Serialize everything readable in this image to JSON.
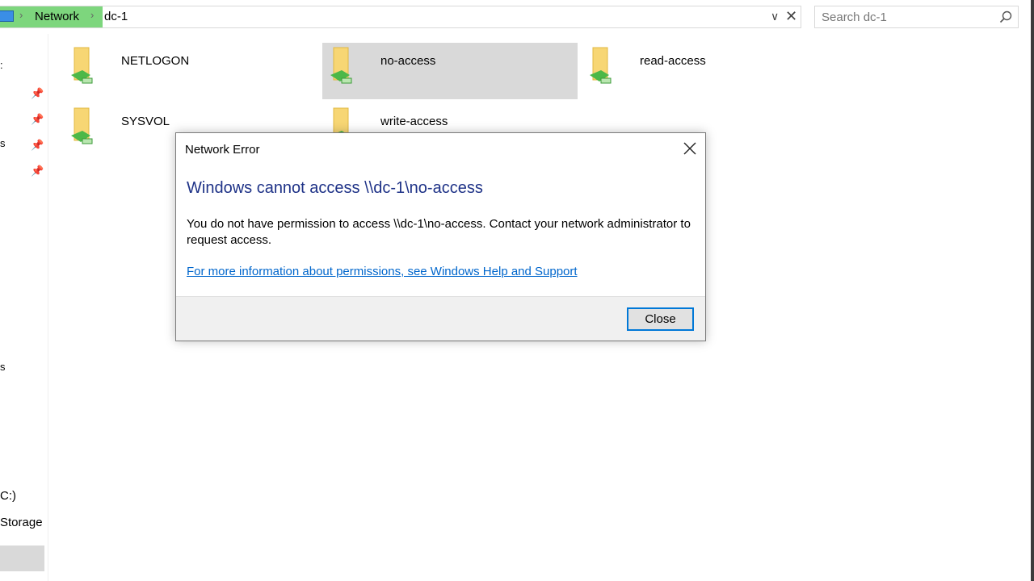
{
  "address_bar": {
    "crumbs": [
      "Network",
      "dc-1"
    ],
    "separator": "›"
  },
  "search": {
    "placeholder": "Search dc-1"
  },
  "nav_pane": {
    "fragments": [
      ":",
      "s",
      "s",
      "C:)",
      "Storage"
    ]
  },
  "items": [
    {
      "label": "NETLOGON"
    },
    {
      "label": "no-access"
    },
    {
      "label": "read-access"
    },
    {
      "label": "SYSVOL"
    },
    {
      "label": "write-access"
    }
  ],
  "dialog": {
    "title": "Network Error",
    "heading": "Windows cannot access \\\\dc-1\\no-access",
    "message": "You do not have permission to access \\\\dc-1\\no-access. Contact your network administrator to request access.",
    "link": "For more information about permissions, see Windows Help and Support",
    "close_button": "Close"
  },
  "colors": {
    "accent": "#0078d7",
    "heading": "#1e3287",
    "link": "#0066cc",
    "breadcrumb_highlight": "#7dd67d",
    "selection": "#d9d9d9"
  },
  "icons": [
    "computer-icon",
    "chevron-right-icon",
    "chevron-down-icon",
    "close-icon",
    "search-icon",
    "pin-icon",
    "shared-folder-icon"
  ]
}
